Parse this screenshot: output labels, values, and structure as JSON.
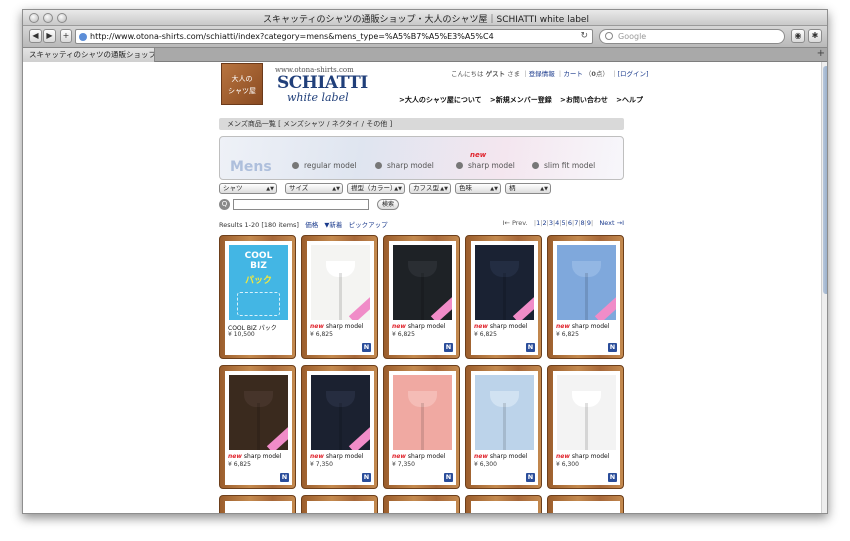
{
  "browser": {
    "window_title": "スキャッティのシャツの通販ショップ・大人のシャツ屋｜SCHIATTI white label",
    "url": "http://www.otona-shirts.com/schiatti/index?category=mens&mens_type=%A5%B7%A5%E3%A5%C4",
    "search_placeholder": "Google",
    "tab_label": "スキャッティのシャツの通販ショップ･･･",
    "back_glyph": "◀",
    "forward_glyph": "▶",
    "plus_glyph": "+",
    "reload_glyph": "↻"
  },
  "header": {
    "logo_text_line1": "大人の",
    "logo_text_line2": "シャツ屋",
    "site_url": "www.otona-shirts.com",
    "brand": "SCHIATTI",
    "brand_sub": "white label",
    "greeting": "こんにちは",
    "guest": "ゲスト",
    "sama": "さま",
    "register": "登録情報",
    "cart": "カート",
    "cart_count": "0",
    "cart_unit": "点",
    "login": "[ログイン]",
    "nav": [
      ">大人のシャツ屋について",
      ">新規メンバー登録",
      ">お問い合わせ",
      ">ヘルプ"
    ]
  },
  "breadcrumb": "メンズ商品一覧 [ メンズシャツ / ネクタイ / その他 ]",
  "models": {
    "mens_label": "Mens",
    "new_label": "new",
    "items": [
      "regular model",
      "sharp model",
      "sharp model",
      "slim fit model"
    ]
  },
  "filters": [
    "シャツ",
    "サイズ",
    "襟型（カラー）",
    "カフス型",
    "色味",
    "柄"
  ],
  "search_button": "検索",
  "results": {
    "count_text": "Results 1-20 [180 items]",
    "sort_price": "価格",
    "sort_new": "▼新着",
    "sort_pickup": "ピックアップ",
    "prev": "I← Prev.",
    "pages": [
      "1",
      "2",
      "3",
      "4",
      "5",
      "6",
      "7",
      "8",
      "9"
    ],
    "next": "Next →I"
  },
  "products": [
    {
      "name": "COOL BIZ パック",
      "price": "¥ 10,500",
      "is_new": false,
      "badge": "",
      "cool_title": "COOL",
      "cool_title2": "BIZ",
      "cool_pack": "パック",
      "shirt": "#43b6e4",
      "collar": "#43b6e4",
      "ribbon": false
    },
    {
      "name": "sharp model",
      "price": "¥ 6,825",
      "is_new": true,
      "badge": "N",
      "shirt": "#f4f4f2",
      "collar": "#ffffff",
      "ribbon": true
    },
    {
      "name": "sharp model",
      "price": "¥ 6,825",
      "is_new": true,
      "badge": "N",
      "shirt": "#1e2226",
      "collar": "#2a2e33",
      "ribbon": true
    },
    {
      "name": "sharp model",
      "price": "¥ 6,825",
      "is_new": true,
      "badge": "N",
      "shirt": "#1a2233",
      "collar": "#232d42",
      "ribbon": true
    },
    {
      "name": "sharp model",
      "price": "¥ 6,825",
      "is_new": true,
      "badge": "N",
      "shirt": "#7fa8dc",
      "collar": "#93b7e4",
      "ribbon": true
    },
    {
      "name": "sharp model",
      "price": "¥ 6,825",
      "is_new": true,
      "badge": "N",
      "shirt": "#3a2a1e",
      "collar": "#46342a",
      "ribbon": true
    },
    {
      "name": "sharp model",
      "price": "¥ 7,350",
      "is_new": true,
      "badge": "N",
      "shirt": "#1b2130",
      "collar": "#262d40",
      "ribbon": true
    },
    {
      "name": "sharp model",
      "price": "¥ 7,350",
      "is_new": true,
      "badge": "N",
      "shirt": "#f0a9a2",
      "collar": "#f5bcb6",
      "ribbon": false
    },
    {
      "name": "sharp model",
      "price": "¥ 6,300",
      "is_new": true,
      "badge": "N",
      "shirt": "#bcd3ea",
      "collar": "#d1e2f2",
      "ribbon": false
    },
    {
      "name": "sharp model",
      "price": "¥ 6,300",
      "is_new": true,
      "badge": "N",
      "shirt": "#f3f3f3",
      "collar": "#ffffff",
      "ribbon": false
    }
  ]
}
